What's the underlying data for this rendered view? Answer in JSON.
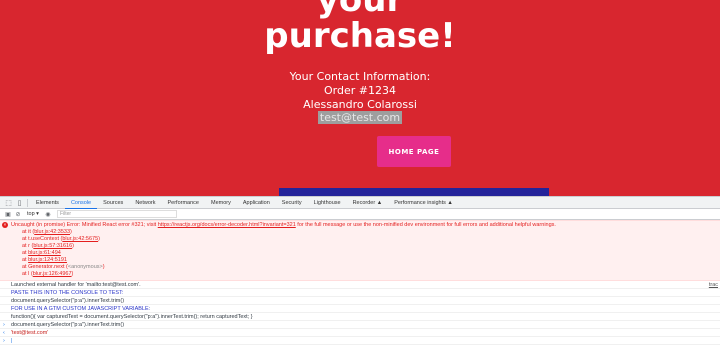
{
  "page": {
    "headline_line1": "your",
    "headline_line2": "purchase!",
    "contact_title": "Your Contact Information:",
    "order": "Order #1234",
    "name": "Alessandro Colarossi",
    "email": "test@test.com",
    "home_button": "HOME PAGE",
    "colors": {
      "background": "#d8262f",
      "button": "#e62d8a",
      "strip": "#24239a"
    }
  },
  "devtools": {
    "tabs": [
      "Elements",
      "Console",
      "Sources",
      "Network",
      "Performance",
      "Memory",
      "Application",
      "Security",
      "Lighthouse",
      "Recorder",
      "Performance insights"
    ],
    "active_tab": "Console",
    "toolbar": {
      "context": "top",
      "filter_placeholder": "Filter"
    },
    "error": {
      "message_prefix": "Uncaught (in promise) Error: Minified React error #321; visit ",
      "message_link": "https://reactjs.org/docs/error-decoder.html?invariant=321",
      "message_suffix": " for the full message or use the non-minified dev environment for full errors and additional helpful warnings.",
      "stack": [
        {
          "fn": "at it (",
          "src": "blur.js:42:3533",
          "end": ")"
        },
        {
          "fn": "at t.useContext (",
          "src": "blur.js:42:5675",
          "end": ")"
        },
        {
          "fn": "at r (",
          "src": "blur.js:57:31616",
          "end": ")"
        },
        {
          "fn": "at ",
          "src": "blur.js:61:494",
          "end": ""
        },
        {
          "fn": "at ",
          "src": "blur.js:124:5191",
          "end": ""
        },
        {
          "fn": "at Generator.next (",
          "src": "<anonymous>",
          "end": ")"
        },
        {
          "fn": "at l (",
          "src": "blur.js:126:4967",
          "end": ")"
        }
      ]
    },
    "logs": [
      {
        "text": "Launched external handler for 'mailto:test@test.com'.",
        "source": "trac",
        "blue": false
      },
      {
        "text": "PASTE THIS INTO THE CONSOLE TO TEST:",
        "source": "",
        "blue": true
      },
      {
        "text": "document.querySelector(\"p:a\").innerText.trim()",
        "source": "",
        "blue": false
      },
      {
        "text": "FOR USE IN A GTM CUSTOM JAVASCRIPT VARIABLE:",
        "source": "",
        "blue": true
      },
      {
        "text": "function(){ var capturedText = document.querySelector(\"p:a\").innerText.trim(); return capturedText; }",
        "source": "",
        "blue": false
      }
    ],
    "input_command": "document.querySelector(\"p:a\").innerText.trim()",
    "result": "'test@test.com'"
  }
}
